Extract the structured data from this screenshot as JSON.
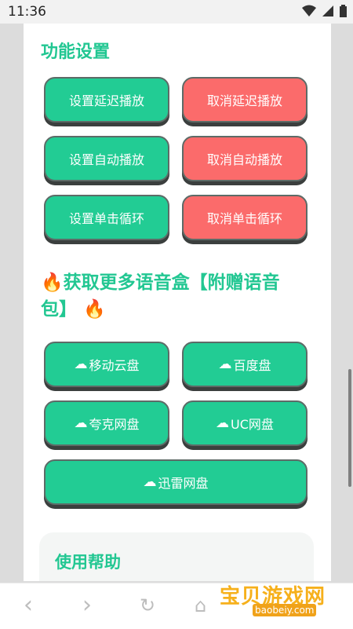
{
  "status_bar": {
    "time": "11:36",
    "icons": [
      "wifi-icon",
      "signal-icon",
      "battery-icon"
    ]
  },
  "settings": {
    "title": "功能设置",
    "buttons": [
      {
        "label": "设置延迟播放",
        "color": "green"
      },
      {
        "label": "取消延迟播放",
        "color": "red"
      },
      {
        "label": "设置自动播放",
        "color": "green"
      },
      {
        "label": "取消自动播放",
        "color": "red"
      },
      {
        "label": "设置单击循环",
        "color": "green"
      },
      {
        "label": "取消单击循环",
        "color": "red"
      }
    ]
  },
  "promo": {
    "title": "获取更多语音盒【附赠语音包】",
    "icon": "fire-icon",
    "buttons": [
      {
        "label": "移动云盘",
        "icon": "cloud-icon"
      },
      {
        "label": "百度盘",
        "icon": "cloud-icon"
      },
      {
        "label": "夸克网盘",
        "icon": "cloud-icon"
      },
      {
        "label": "UC网盘",
        "icon": "cloud-icon"
      },
      {
        "label": "迅雷网盘",
        "icon": "cloud-icon"
      }
    ]
  },
  "help": {
    "title": "使用帮助"
  },
  "watermark": {
    "text": "宝贝游戏网",
    "url": "baobeiy.com"
  },
  "colors": {
    "green": "#22cc94",
    "red": "#fb6b6b",
    "accent": "#22c792"
  }
}
